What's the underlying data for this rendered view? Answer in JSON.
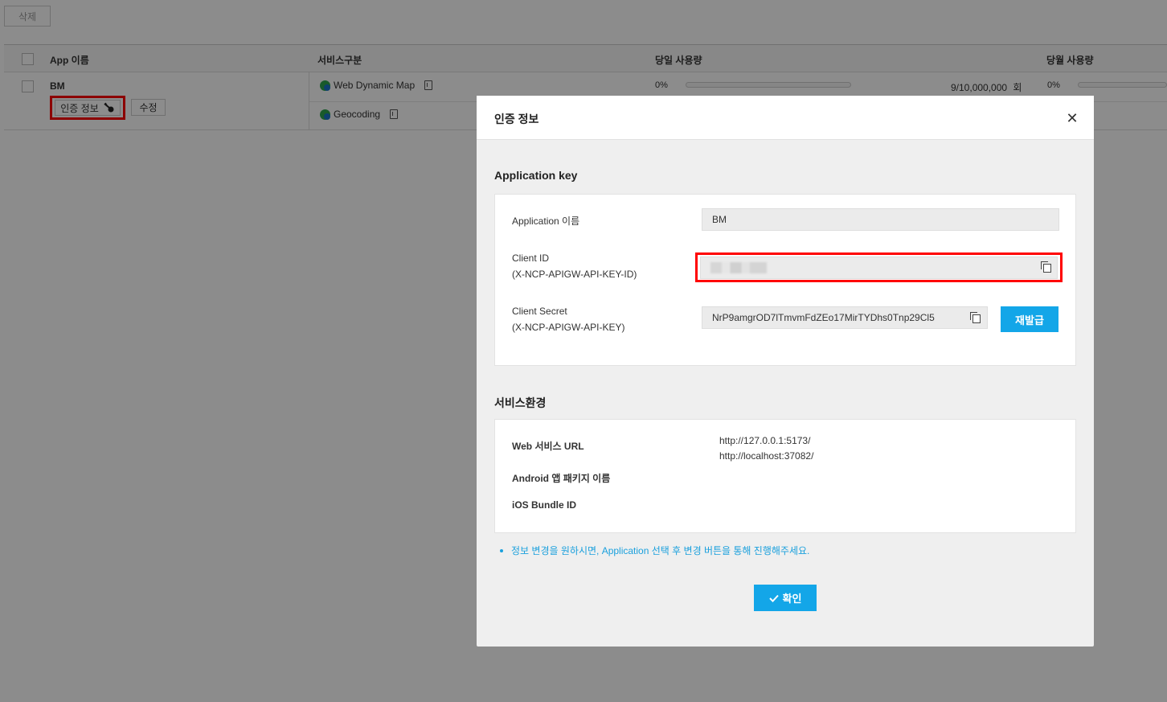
{
  "toolbar": {
    "delete_label": "삭제"
  },
  "table": {
    "headers": {
      "app_name": "App 이름",
      "service_type": "서비스구분",
      "daily_usage": "당일 사용량",
      "monthly_usage": "당월 사용량"
    },
    "row": {
      "app_name": "BM",
      "auth_button": "인증 정보",
      "edit_button": "수정",
      "services": [
        {
          "name": "Web Dynamic Map",
          "daily_pct": "0%",
          "daily_fill": 0,
          "count": "9/10,000,000",
          "count_unit": "회",
          "monthly_pct": "0%"
        },
        {
          "name": "Geocoding"
        }
      ]
    }
  },
  "modal": {
    "title": "인증 정보",
    "close_icon": "close-icon",
    "app_key_section": {
      "title": "Application key",
      "app_name_label": "Application 이름",
      "app_name_value": "BM",
      "client_id_label_1": "Client ID",
      "client_id_label_2": "(X-NCP-APIGW-API-KEY-ID)",
      "client_secret_label_1": "Client Secret",
      "client_secret_label_2": "(X-NCP-APIGW-API-KEY)",
      "client_secret_value": "NrP9amgrOD7lTmvmFdZEo17MirTYDhs0Tnp29Cl5",
      "reissue_button": "재발급"
    },
    "service_env_section": {
      "title": "서비스환경",
      "web_url_label": "Web 서비스 URL",
      "web_urls": [
        "http://127.0.0.1:5173/",
        "http://localhost:37082/"
      ],
      "android_label": "Android 앱 패키지 이름",
      "ios_label": "iOS Bundle ID"
    },
    "note": "정보 변경을 원하시면, Application 선택 후 변경 버튼을 통해 진행해주세요.",
    "confirm_button": "확인"
  }
}
